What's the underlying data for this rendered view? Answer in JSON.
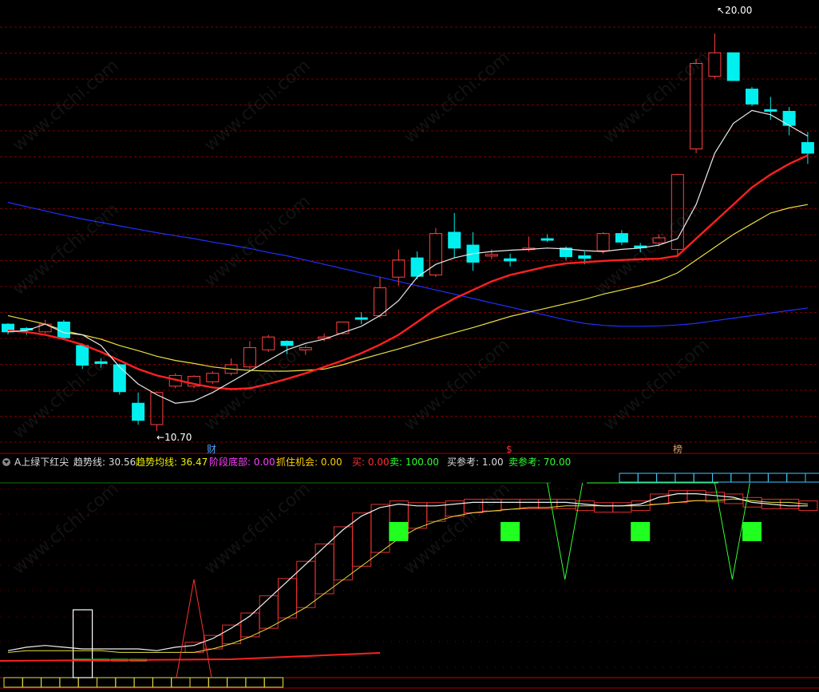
{
  "price_panel": {
    "high_label": "20.00",
    "low_label": "10.70",
    "event_markers": [
      {
        "text": "财",
        "color": "#4aa3ff"
      },
      {
        "text": "$",
        "color": "#ff3030"
      },
      {
        "text": "榜",
        "color": "#d8a060"
      }
    ],
    "candles": [
      {
        "o": 13.2,
        "c": 13.02,
        "h": 13.22,
        "l": 12.96
      },
      {
        "o": 13.1,
        "c": 13.07,
        "h": 13.13,
        "l": 12.95
      },
      {
        "o": 13.02,
        "c": 13.2,
        "h": 13.3,
        "l": 12.98
      },
      {
        "o": 13.25,
        "c": 12.88,
        "h": 13.3,
        "l": 12.85
      },
      {
        "o": 12.7,
        "c": 12.24,
        "h": 12.75,
        "l": 12.15
      },
      {
        "o": 12.32,
        "c": 12.28,
        "h": 12.4,
        "l": 12.18
      },
      {
        "o": 12.25,
        "c": 11.62,
        "h": 12.28,
        "l": 11.55
      },
      {
        "o": 11.35,
        "c": 10.95,
        "h": 11.6,
        "l": 10.85
      },
      {
        "o": 10.85,
        "c": 11.6,
        "h": 11.63,
        "l": 10.7
      },
      {
        "o": 11.75,
        "c": 12.0,
        "h": 12.05,
        "l": 11.7
      },
      {
        "o": 11.75,
        "c": 11.98,
        "h": 12.0,
        "l": 11.7
      },
      {
        "o": 11.85,
        "c": 12.05,
        "h": 12.1,
        "l": 11.8
      },
      {
        "o": 12.05,
        "c": 12.25,
        "h": 12.4,
        "l": 12.0
      },
      {
        "o": 12.2,
        "c": 12.65,
        "h": 12.8,
        "l": 12.15
      },
      {
        "o": 12.6,
        "c": 12.9,
        "h": 12.95,
        "l": 12.55
      },
      {
        "o": 12.8,
        "c": 12.7,
        "h": 12.82,
        "l": 12.5
      },
      {
        "o": 12.6,
        "c": 12.65,
        "h": 12.7,
        "l": 12.48
      },
      {
        "o": 12.88,
        "c": 12.9,
        "h": 12.98,
        "l": 12.8
      },
      {
        "o": 12.98,
        "c": 13.25,
        "h": 13.25,
        "l": 12.96
      },
      {
        "o": 13.35,
        "c": 13.32,
        "h": 13.48,
        "l": 13.2
      },
      {
        "o": 13.4,
        "c": 14.05,
        "h": 14.3,
        "l": 13.35
      },
      {
        "o": 14.3,
        "c": 14.7,
        "h": 14.95,
        "l": 14.1
      },
      {
        "o": 14.75,
        "c": 14.32,
        "h": 14.9,
        "l": 14.25
      },
      {
        "o": 14.35,
        "c": 15.32,
        "h": 15.45,
        "l": 14.3
      },
      {
        "o": 15.35,
        "c": 14.98,
        "h": 15.8,
        "l": 14.75
      },
      {
        "o": 15.05,
        "c": 14.65,
        "h": 15.35,
        "l": 14.45
      },
      {
        "o": 14.8,
        "c": 14.83,
        "h": 14.95,
        "l": 14.72
      },
      {
        "o": 14.73,
        "c": 14.68,
        "h": 14.85,
        "l": 14.55
      },
      {
        "o": 14.95,
        "c": 14.98,
        "h": 15.25,
        "l": 14.9
      },
      {
        "o": 15.2,
        "c": 15.18,
        "h": 15.3,
        "l": 15.12
      },
      {
        "o": 14.98,
        "c": 14.78,
        "h": 15.02,
        "l": 14.7
      },
      {
        "o": 14.8,
        "c": 14.74,
        "h": 14.9,
        "l": 14.6
      },
      {
        "o": 14.92,
        "c": 15.32,
        "h": 15.35,
        "l": 14.85
      },
      {
        "o": 15.32,
        "c": 15.12,
        "h": 15.4,
        "l": 15.05
      },
      {
        "o": 15.03,
        "c": 14.99,
        "h": 15.1,
        "l": 14.88
      },
      {
        "o": 15.1,
        "c": 15.22,
        "h": 15.3,
        "l": 15.02
      },
      {
        "o": 14.95,
        "c": 16.7,
        "h": 16.72,
        "l": 14.8
      },
      {
        "o": 17.3,
        "c": 19.3,
        "h": 19.4,
        "l": 17.2
      },
      {
        "o": 19.0,
        "c": 19.55,
        "h": 20.0,
        "l": 18.95
      },
      {
        "o": 19.55,
        "c": 18.9,
        "h": 19.55,
        "l": 18.9
      },
      {
        "o": 18.7,
        "c": 18.35,
        "h": 18.75,
        "l": 18.3
      },
      {
        "o": 18.22,
        "c": 18.18,
        "h": 18.52,
        "l": 17.98
      },
      {
        "o": 18.18,
        "c": 17.85,
        "h": 18.28,
        "l": 17.62
      },
      {
        "o": 17.45,
        "c": 17.2,
        "h": 17.7,
        "l": 16.95
      }
    ],
    "ma_white": [
      13.02,
      13.05,
      13.2,
      13.0,
      12.95,
      12.7,
      12.2,
      11.8,
      11.55,
      11.35,
      11.4,
      11.6,
      11.85,
      12.1,
      12.35,
      12.6,
      12.75,
      12.85,
      13.0,
      13.15,
      13.4,
      13.75,
      14.3,
      14.6,
      14.75,
      14.85,
      14.9,
      14.93,
      14.95,
      14.98,
      14.96,
      14.92,
      14.9,
      14.95,
      14.98,
      15.05,
      15.2,
      16.0,
      17.2,
      17.9,
      18.2,
      18.1,
      17.85,
      17.6
    ],
    "ma_red": [
      13.05,
      13.02,
      12.95,
      12.85,
      12.72,
      12.55,
      12.35,
      12.15,
      12.0,
      11.9,
      11.8,
      11.72,
      11.68,
      11.7,
      11.8,
      11.92,
      12.05,
      12.2,
      12.35,
      12.52,
      12.72,
      12.95,
      13.25,
      13.55,
      13.8,
      14.0,
      14.2,
      14.35,
      14.45,
      14.55,
      14.62,
      14.65,
      14.68,
      14.7,
      14.72,
      14.73,
      14.8,
      15.2,
      15.6,
      16.0,
      16.4,
      16.7,
      16.95,
      17.15
    ],
    "ma_yellow": [
      13.4,
      13.3,
      13.2,
      13.05,
      12.95,
      12.85,
      12.7,
      12.58,
      12.45,
      12.35,
      12.28,
      12.2,
      12.15,
      12.12,
      12.1,
      12.1,
      12.12,
      12.15,
      12.25,
      12.38,
      12.5,
      12.62,
      12.75,
      12.88,
      13.0,
      13.12,
      13.25,
      13.38,
      13.48,
      13.58,
      13.68,
      13.78,
      13.9,
      14.0,
      14.1,
      14.22,
      14.4,
      14.7,
      15.0,
      15.3,
      15.55,
      15.8,
      15.92,
      16.0
    ],
    "ma_blue": [
      16.05,
      15.95,
      15.85,
      15.75,
      15.66,
      15.58,
      15.5,
      15.42,
      15.34,
      15.27,
      15.2,
      15.12,
      15.05,
      14.97,
      14.88,
      14.8,
      14.7,
      14.6,
      14.5,
      14.4,
      14.3,
      14.2,
      14.1,
      14.0,
      13.9,
      13.8,
      13.7,
      13.6,
      13.5,
      13.4,
      13.3,
      13.22,
      13.17,
      13.15,
      13.15,
      13.16,
      13.18,
      13.22,
      13.28,
      13.34,
      13.4,
      13.46,
      13.52,
      13.58
    ]
  },
  "indicator_panel": {
    "title": "A上绿下红尖",
    "items": [
      {
        "label": "趋势线:",
        "value": "30.56",
        "color": "#dddddd"
      },
      {
        "label": "趋势均线:",
        "value": "36.47",
        "color": "#f0f000"
      },
      {
        "label": "阶段底部:",
        "value": "0.00",
        "color": "#ff40ff"
      },
      {
        "label": "抓住机会:",
        "value": "0.00",
        "color": "#ffcc00"
      },
      {
        "label": "买:",
        "value": "0.00",
        "color": "#ff3030"
      },
      {
        "label": "卖:",
        "value": "100.00",
        "color": "#30ff30"
      },
      {
        "label": "买参考:",
        "value": "1.00",
        "color": "#dddddd"
      },
      {
        "label": "卖参考:",
        "value": "70.00",
        "color": "#30ff30"
      }
    ],
    "trend_line": [
      5,
      7,
      8,
      7,
      6,
      6,
      6,
      6,
      5,
      7,
      8,
      12,
      18,
      25,
      35,
      45,
      55,
      65,
      75,
      83,
      88,
      90,
      89,
      89,
      90,
      91,
      91,
      91,
      91,
      91,
      91,
      90,
      89,
      89,
      90,
      94,
      96,
      96,
      95,
      94,
      91,
      90,
      89,
      89
    ],
    "trend_avg": [
      4,
      5,
      5,
      5,
      5,
      5,
      4,
      4,
      4,
      4,
      4,
      6,
      9,
      13,
      18,
      24,
      30,
      38,
      46,
      54,
      62,
      70,
      76,
      80,
      83,
      85,
      86,
      87,
      88,
      88,
      89,
      89,
      89,
      89,
      89,
      90,
      91,
      92,
      92,
      93,
      92,
      91,
      91,
      90
    ],
    "green_bars": [
      0,
      0,
      0,
      0,
      1,
      1,
      1,
      1,
      0,
      0
    ],
    "buy_signal_index": 20,
    "red_spike_index": 10,
    "white_block_index": 2,
    "sell_signal_indexes": [
      29,
      38
    ]
  },
  "colors": {
    "up": "#ff4040",
    "down": "#00f0f0",
    "grid": "#7a0000"
  },
  "watermark": "www.cfchi.com"
}
